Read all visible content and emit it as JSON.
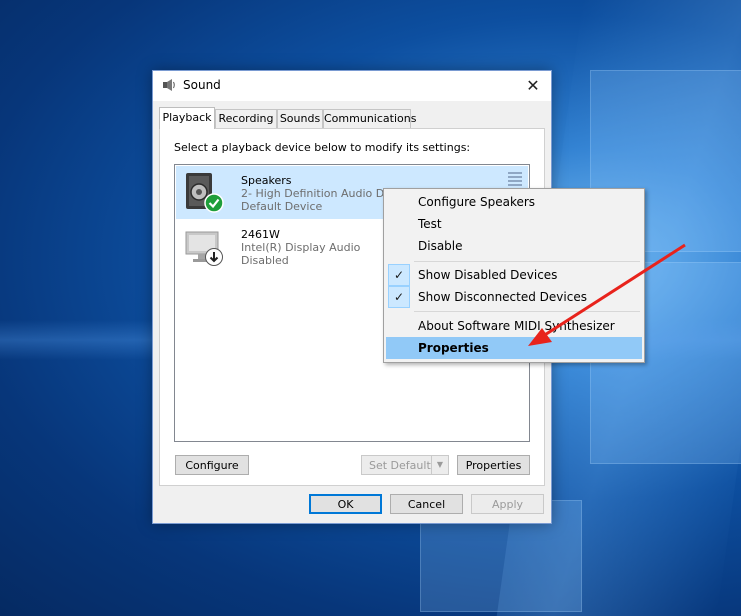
{
  "window": {
    "title": "Sound",
    "close_glyph": "✕"
  },
  "tabs": [
    {
      "label": "Playback",
      "active": true
    },
    {
      "label": "Recording",
      "active": false
    },
    {
      "label": "Sounds",
      "active": false
    },
    {
      "label": "Communications",
      "active": false
    }
  ],
  "playback": {
    "instruction": "Select a playback device below to modify its settings:",
    "devices": [
      {
        "name": "Speakers",
        "line1": "2- High Definition Audio De",
        "line2": "Default Device",
        "status_icon": "green-check-icon",
        "selected": true
      },
      {
        "name": "2461W",
        "line1": "Intel(R) Display Audio",
        "line2": "Disabled",
        "status_icon": "down-arrow-icon",
        "selected": false
      }
    ],
    "buttons": {
      "configure": "Configure",
      "set_default": "Set Default",
      "properties": "Properties"
    }
  },
  "footer": {
    "ok": "OK",
    "cancel": "Cancel",
    "apply": "Apply"
  },
  "context_menu": {
    "items": [
      {
        "label": "Configure Speakers"
      },
      {
        "label": "Test"
      },
      {
        "label": "Disable"
      },
      {
        "label": "Show Disabled Devices",
        "checked": true
      },
      {
        "label": "Show Disconnected Devices",
        "checked": true
      },
      {
        "label": "About Software MIDI Synthesizer"
      },
      {
        "label": "Properties",
        "highlighted": true
      }
    ],
    "check_glyph": "✓"
  },
  "colors": {
    "accent": "#0078d7",
    "selection": "#cde8ff",
    "menu_highlight": "#91c9f7",
    "annotation_arrow": "#e8231c"
  }
}
